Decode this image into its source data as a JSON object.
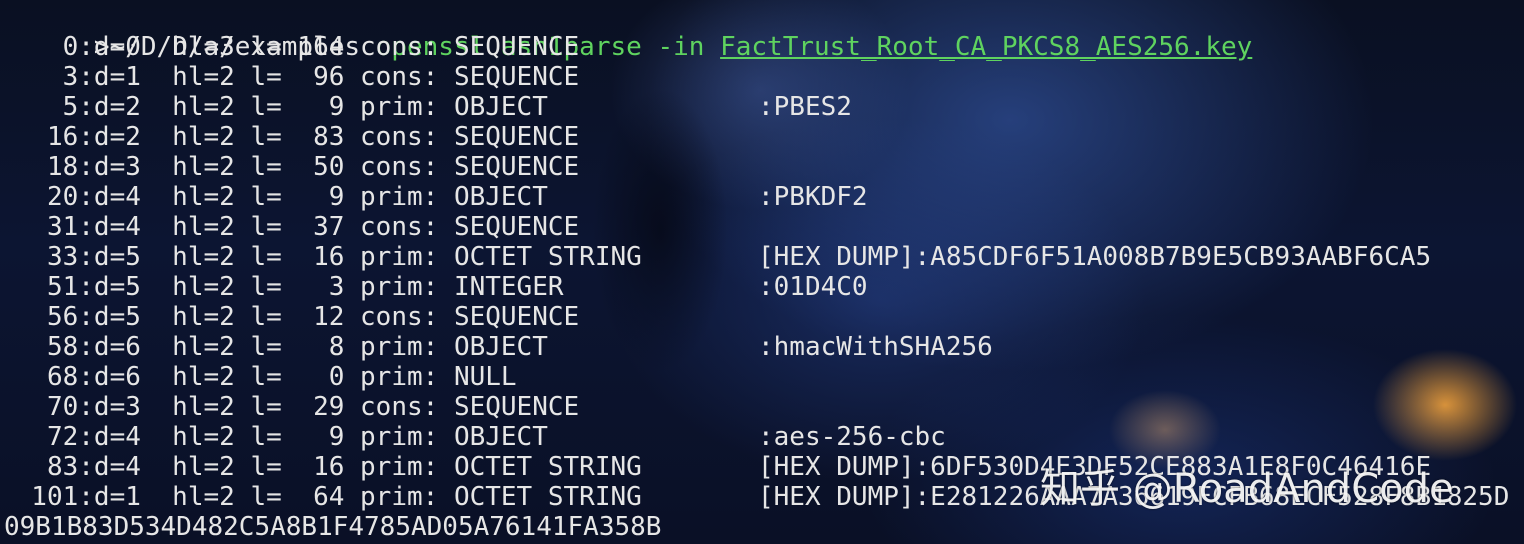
{
  "prompt": {
    "marker": ">",
    "path": "~/D/D/a/examples",
    "command": "openssl asn1parse -in",
    "file": "FactTrust_Root_CA_PKCS8_AES256.key"
  },
  "rows": [
    {
      "left": "    0:d=0  hl=3 l= 164 cons: SEQUENCE",
      "right": ""
    },
    {
      "left": "    3:d=1  hl=2 l=  96 cons: SEQUENCE",
      "right": ""
    },
    {
      "left": "    5:d=2  hl=2 l=   9 prim: OBJECT",
      "right": ":PBES2"
    },
    {
      "left": "   16:d=2  hl=2 l=  83 cons: SEQUENCE",
      "right": ""
    },
    {
      "left": "   18:d=3  hl=2 l=  50 cons: SEQUENCE",
      "right": ""
    },
    {
      "left": "   20:d=4  hl=2 l=   9 prim: OBJECT",
      "right": ":PBKDF2"
    },
    {
      "left": "   31:d=4  hl=2 l=  37 cons: SEQUENCE",
      "right": ""
    },
    {
      "left": "   33:d=5  hl=2 l=  16 prim: OCTET STRING",
      "right": "[HEX DUMP]:A85CDF6F51A008B7B9E5CB93AABF6CA5"
    },
    {
      "left": "   51:d=5  hl=2 l=   3 prim: INTEGER",
      "right": ":01D4C0"
    },
    {
      "left": "   56:d=5  hl=2 l=  12 cons: SEQUENCE",
      "right": ""
    },
    {
      "left": "   58:d=6  hl=2 l=   8 prim: OBJECT",
      "right": ":hmacWithSHA256"
    },
    {
      "left": "   68:d=6  hl=2 l=   0 prim: NULL",
      "right": ""
    },
    {
      "left": "   70:d=3  hl=2 l=  29 cons: SEQUENCE",
      "right": ""
    },
    {
      "left": "   72:d=4  hl=2 l=   9 prim: OBJECT",
      "right": ":aes-256-cbc"
    },
    {
      "left": "   83:d=4  hl=2 l=  16 prim: OCTET STRING",
      "right": "[HEX DUMP]:6DF530D4E3DF52CE883A1E8F0C46416E"
    },
    {
      "left": "  101:d=1  hl=2 l=  64 prim: OCTET STRING",
      "right": "[HEX DUMP]:E281226AAA7A36619FCFB68ECF528F8B1825D"
    }
  ],
  "continuation": "09B1B83D534D482C5A8B1F4785AD05A76141FA358B",
  "watermark": "知乎 @RoadAndCode",
  "colors": {
    "command": "#5fd35f",
    "text": "#e6e6e6",
    "background": "#070b1c"
  }
}
